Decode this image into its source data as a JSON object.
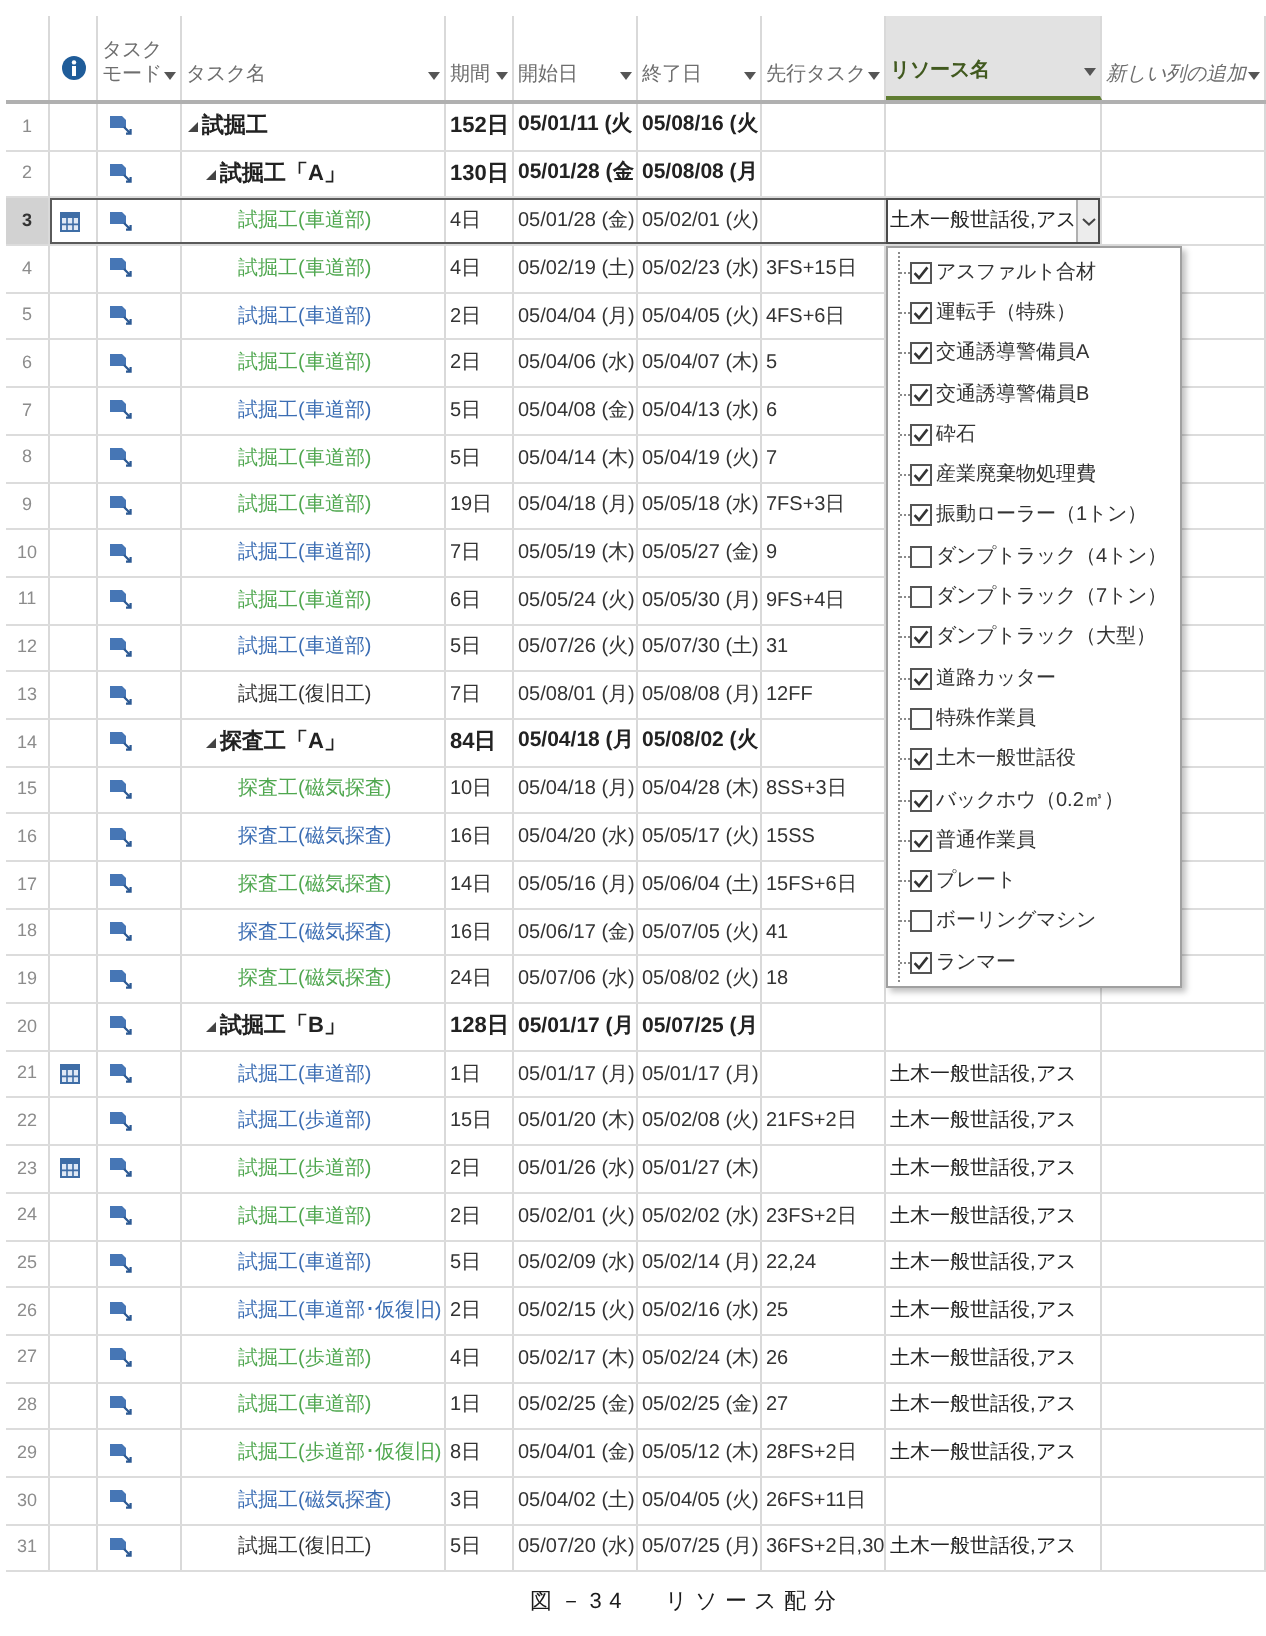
{
  "table": {
    "columns": [
      {
        "kind": "icon",
        "selected": false
      },
      {
        "kind": "text",
        "label": "タスクモード",
        "selected": false
      },
      {
        "kind": "text",
        "label": "タスク名",
        "selected": false
      },
      {
        "kind": "text",
        "label": "期間",
        "selected": false
      },
      {
        "kind": "text",
        "label": "開始日",
        "selected": false
      },
      {
        "kind": "text",
        "label": "終了日",
        "selected": false
      },
      {
        "kind": "text",
        "label": "先行タスク",
        "selected": false
      },
      {
        "kind": "text",
        "label": "リソース名",
        "selected": true
      },
      {
        "kind": "add",
        "label": "新しい列の追加",
        "selected": false
      }
    ],
    "tasks": [
      {
        "row_number": "1",
        "kind": "summary",
        "name": "試掘工",
        "duration": "152日",
        "start": "05/01/11 (火",
        "finish": "05/08/16 (火",
        "calendar_indicator": false,
        "selected": false,
        "expanded": true,
        "children": [
          {
            "row_number": "2",
            "kind": "summary",
            "name": "試掘工「A」",
            "duration": "130日",
            "start": "05/01/28 (金",
            "finish": "05/08/08 (月",
            "calendar_indicator": false,
            "selected": false,
            "expanded": true,
            "children": [
              {
                "row_number": "3",
                "kind": "task",
                "name": "試掘工(車道部)",
                "color": "#4fa74f",
                "duration": "4日",
                "start": "05/01/28 (金)",
                "finish": "05/02/01 (火)",
                "resources": "土木一般世話役,アス",
                "calendar_indicator": true,
                "selected": true
              },
              {
                "row_number": "4",
                "kind": "task",
                "name": "試掘工(車道部)",
                "color": "#4fa74f",
                "duration": "4日",
                "start": "05/02/19 (土)",
                "finish": "05/02/23 (水)",
                "predecessors": "3FS+15日",
                "calendar_indicator": false,
                "selected": false
              },
              {
                "row_number": "5",
                "kind": "task",
                "name": "試掘工(車道部)",
                "color": "#3b6db3",
                "duration": "2日",
                "start": "05/04/04 (月)",
                "finish": "05/04/05 (火)",
                "predecessors": "4FS+6日",
                "calendar_indicator": false,
                "selected": false
              },
              {
                "row_number": "6",
                "kind": "task",
                "name": "試掘工(車道部)",
                "color": "#4fa74f",
                "duration": "2日",
                "start": "05/04/06 (水)",
                "finish": "05/04/07 (木)",
                "predecessors": "5",
                "calendar_indicator": false,
                "selected": false
              },
              {
                "row_number": "7",
                "kind": "task",
                "name": "試掘工(車道部)",
                "color": "#3b6db3",
                "duration": "5日",
                "start": "05/04/08 (金)",
                "finish": "05/04/13 (水)",
                "predecessors": "6",
                "calendar_indicator": false,
                "selected": false
              },
              {
                "row_number": "8",
                "kind": "task",
                "name": "試掘工(車道部)",
                "color": "#4fa74f",
                "duration": "5日",
                "start": "05/04/14 (木)",
                "finish": "05/04/19 (火)",
                "predecessors": "7",
                "calendar_indicator": false,
                "selected": false
              },
              {
                "row_number": "9",
                "kind": "task",
                "name": "試掘工(車道部)",
                "color": "#4fa74f",
                "duration": "19日",
                "start": "05/04/18 (月)",
                "finish": "05/05/18 (水)",
                "predecessors": "7FS+3日",
                "calendar_indicator": false,
                "selected": false
              },
              {
                "row_number": "10",
                "kind": "task",
                "name": "試掘工(車道部)",
                "color": "#3b6db3",
                "duration": "7日",
                "start": "05/05/19 (木)",
                "finish": "05/05/27 (金)",
                "predecessors": "9",
                "calendar_indicator": false,
                "selected": false
              },
              {
                "row_number": "11",
                "kind": "task",
                "name": "試掘工(車道部)",
                "color": "#4fa74f",
                "duration": "6日",
                "start": "05/05/24 (火)",
                "finish": "05/05/30 (月)",
                "predecessors": "9FS+4日",
                "calendar_indicator": false,
                "selected": false
              },
              {
                "row_number": "12",
                "kind": "task",
                "name": "試掘工(車道部)",
                "color": "#3b6db3",
                "duration": "5日",
                "start": "05/07/26 (火)",
                "finish": "05/07/30 (土)",
                "predecessors": "31",
                "calendar_indicator": false,
                "selected": false
              },
              {
                "row_number": "13",
                "kind": "task",
                "name": "試掘工(復旧工)",
                "color": "#333333",
                "duration": "7日",
                "start": "05/08/01 (月)",
                "finish": "05/08/08 (月)",
                "predecessors": "12FF",
                "calendar_indicator": false,
                "selected": false
              }
            ]
          },
          {
            "row_number": "14",
            "kind": "summary",
            "name": "探査工「A」",
            "duration": "84日",
            "start": "05/04/18 (月",
            "finish": "05/08/02 (火",
            "calendar_indicator": false,
            "selected": false,
            "expanded": true,
            "children": [
              {
                "row_number": "15",
                "kind": "task",
                "name": "探査工(磁気探査)",
                "color": "#4fa74f",
                "duration": "10日",
                "start": "05/04/18 (月)",
                "finish": "05/04/28 (木)",
                "predecessors": "8SS+3日",
                "calendar_indicator": false,
                "selected": false
              },
              {
                "row_number": "16",
                "kind": "task",
                "name": "探査工(磁気探査)",
                "color": "#3b6db3",
                "duration": "16日",
                "start": "05/04/20 (水)",
                "finish": "05/05/17 (火)",
                "predecessors": "15SS",
                "calendar_indicator": false,
                "selected": false
              },
              {
                "row_number": "17",
                "kind": "task",
                "name": "探査工(磁気探査)",
                "color": "#4fa74f",
                "duration": "14日",
                "start": "05/05/16 (月)",
                "finish": "05/06/04 (土)",
                "predecessors": "15FS+6日",
                "calendar_indicator": false,
                "selected": false
              },
              {
                "row_number": "18",
                "kind": "task",
                "name": "探査工(磁気探査)",
                "color": "#3b6db3",
                "duration": "16日",
                "start": "05/06/17 (金)",
                "finish": "05/07/05 (火)",
                "predecessors": "41",
                "calendar_indicator": false,
                "selected": false
              },
              {
                "row_number": "19",
                "kind": "task",
                "name": "探査工(磁気探査)",
                "color": "#4fa74f",
                "duration": "24日",
                "start": "05/07/06 (水)",
                "finish": "05/08/02 (火)",
                "predecessors": "18",
                "calendar_indicator": false,
                "selected": false
              }
            ]
          },
          {
            "row_number": "20",
            "kind": "summary",
            "name": "試掘工「B」",
            "duration": "128日",
            "start": "05/01/17 (月",
            "finish": "05/07/25 (月",
            "calendar_indicator": false,
            "selected": false,
            "expanded": true,
            "children": [
              {
                "row_number": "21",
                "kind": "task",
                "name": "試掘工(車道部)",
                "color": "#3b6db3",
                "duration": "1日",
                "start": "05/01/17 (月)",
                "finish": "05/01/17 (月)",
                "resources": "土木一般世話役,アス",
                "calendar_indicator": true,
                "selected": false
              },
              {
                "row_number": "22",
                "kind": "task",
                "name": "試掘工(歩道部)",
                "color": "#3b6db3",
                "duration": "15日",
                "start": "05/01/20 (木)",
                "finish": "05/02/08 (火)",
                "predecessors": "21FS+2日",
                "resources": "土木一般世話役,アス",
                "calendar_indicator": false,
                "selected": false
              },
              {
                "row_number": "23",
                "kind": "task",
                "name": "試掘工(歩道部)",
                "color": "#4fa74f",
                "duration": "2日",
                "start": "05/01/26 (水)",
                "finish": "05/01/27 (木)",
                "resources": "土木一般世話役,アス",
                "calendar_indicator": true,
                "selected": false
              },
              {
                "row_number": "24",
                "kind": "task",
                "name": "試掘工(車道部)",
                "color": "#4fa74f",
                "duration": "2日",
                "start": "05/02/01 (火)",
                "finish": "05/02/02 (水)",
                "predecessors": "23FS+2日",
                "resources": "土木一般世話役,アス",
                "calendar_indicator": false,
                "selected": false
              },
              {
                "row_number": "25",
                "kind": "task",
                "name": "試掘工(車道部)",
                "color": "#3b6db3",
                "duration": "5日",
                "start": "05/02/09 (水)",
                "finish": "05/02/14 (月)",
                "predecessors": "22,24",
                "resources": "土木一般世話役,アス",
                "calendar_indicator": false,
                "selected": false
              },
              {
                "row_number": "26",
                "kind": "task",
                "name": "試掘工(車道部･仮復旧)",
                "color": "#3b6db3",
                "duration": "2日",
                "start": "05/02/15 (火)",
                "finish": "05/02/16 (水)",
                "predecessors": "25",
                "resources": "土木一般世話役,アス",
                "calendar_indicator": false,
                "selected": false
              },
              {
                "row_number": "27",
                "kind": "task",
                "name": "試掘工(歩道部)",
                "color": "#4fa74f",
                "duration": "4日",
                "start": "05/02/17 (木)",
                "finish": "05/02/24 (木)",
                "predecessors": "26",
                "resources": "土木一般世話役,アス",
                "calendar_indicator": false,
                "selected": false
              },
              {
                "row_number": "28",
                "kind": "task",
                "name": "試掘工(車道部)",
                "color": "#4fa74f",
                "duration": "1日",
                "start": "05/02/25 (金)",
                "finish": "05/02/25 (金)",
                "predecessors": "27",
                "resources": "土木一般世話役,アス",
                "calendar_indicator": false,
                "selected": false
              },
              {
                "row_number": "29",
                "kind": "task",
                "name": "試掘工(歩道部･仮復旧)",
                "color": "#4fa74f",
                "duration": "8日",
                "start": "05/04/01 (金)",
                "finish": "05/05/12 (木)",
                "predecessors": "28FS+2日",
                "resources": "土木一般世話役,アス",
                "calendar_indicator": false,
                "selected": false
              },
              {
                "row_number": "30",
                "kind": "task",
                "name": "試掘工(磁気探査)",
                "color": "#3b6db3",
                "duration": "3日",
                "start": "05/04/02 (土)",
                "finish": "05/04/05 (火)",
                "predecessors": "26FS+11日",
                "calendar_indicator": false,
                "selected": false
              },
              {
                "row_number": "31",
                "kind": "task",
                "name": "試掘工(復旧工)",
                "color": "#333333",
                "duration": "5日",
                "start": "05/07/20 (水)",
                "finish": "05/07/25 (月)",
                "predecessors": "36FS+2日,30",
                "resources": "土木一般世話役,アス",
                "calendar_indicator": false,
                "selected": false
              }
            ]
          }
        ]
      }
    ]
  },
  "resource_dropdown": {
    "items": [
      {
        "label": "アスファルト合材",
        "checked": true
      },
      {
        "label": "運転手（特殊）",
        "checked": true
      },
      {
        "label": "交通誘導警備員A",
        "checked": true
      },
      {
        "label": "交通誘導警備員B",
        "checked": true
      },
      {
        "label": "砕石",
        "checked": true
      },
      {
        "label": "産業廃棄物処理費",
        "checked": true
      },
      {
        "label": "振動ローラー（1トン）",
        "checked": true
      },
      {
        "label": "ダンプトラック（4トン）",
        "checked": false
      },
      {
        "label": "ダンプトラック（7トン）",
        "checked": false
      },
      {
        "label": "ダンプトラック（大型）",
        "checked": true
      },
      {
        "label": "道路カッター",
        "checked": true
      },
      {
        "label": "特殊作業員",
        "checked": false
      },
      {
        "label": "土木一般世話役",
        "checked": true
      },
      {
        "label": "バックホウ（0.2㎥）",
        "checked": true
      },
      {
        "label": "普通作業員",
        "checked": true
      },
      {
        "label": "プレート",
        "checked": true
      },
      {
        "label": "ボーリングマシン",
        "checked": false
      },
      {
        "label": "ランマー",
        "checked": true
      }
    ]
  },
  "caption": {
    "number": "図－34",
    "title": "リソース配分"
  }
}
